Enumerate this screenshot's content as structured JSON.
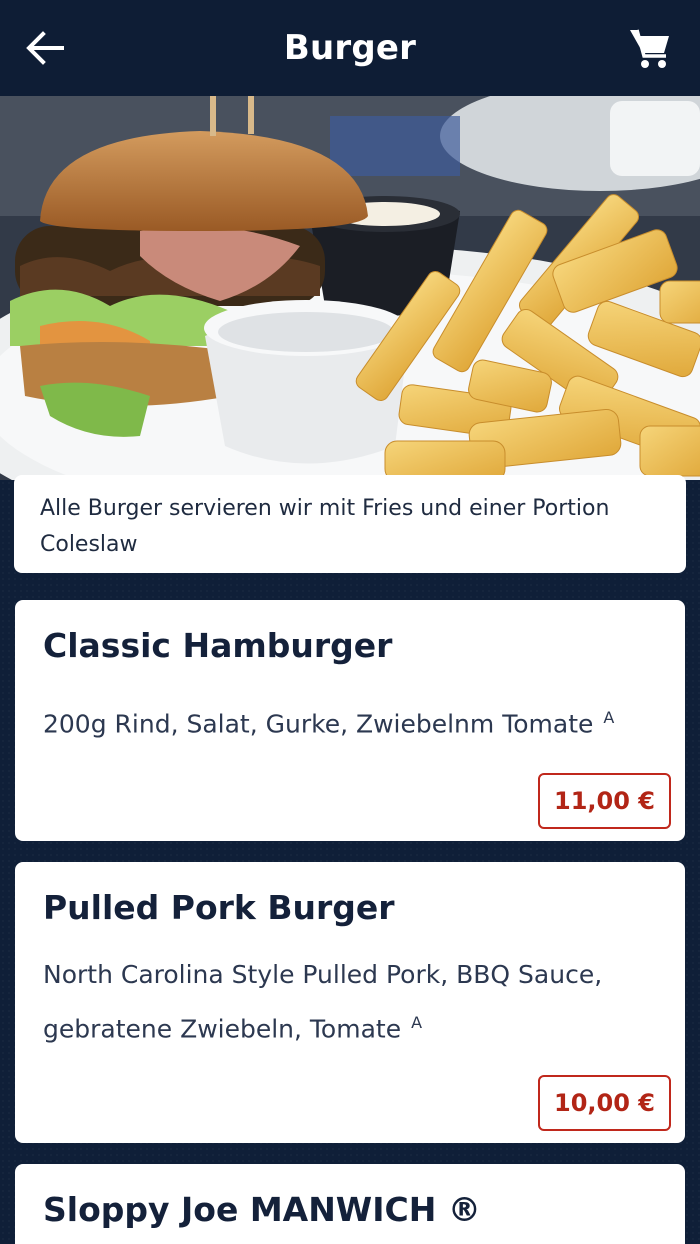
{
  "header": {
    "title": "Burger",
    "back_icon": "arrow-left-icon",
    "cart_icon": "shopping-cart-icon"
  },
  "colors": {
    "background": "#0f1f38",
    "app_bar": "#0e1d35",
    "price_accent": "#c0281c",
    "card": "#ffffff"
  },
  "hero_image": {
    "subject": "burger with fries and dip"
  },
  "intro": {
    "text": "Alle Burger servieren wir mit Fries und einer Portion Coleslaw"
  },
  "items": [
    {
      "title": "Classic Hamburger",
      "description": "200g Rind, Salat, Gurke, Zwiebelnm Tomate",
      "allergen": "A",
      "price": "11,00 €"
    },
    {
      "title": "Pulled Pork Burger",
      "description": "North Carolina Style Pulled Pork, BBQ Sauce, gebratene Zwiebeln, Tomate",
      "allergen": "A",
      "price": "10,00 €"
    },
    {
      "title": "Sloppy Joe MANWICH ®"
    }
  ]
}
